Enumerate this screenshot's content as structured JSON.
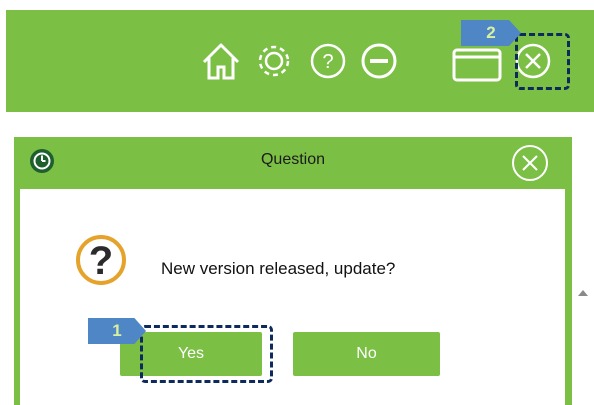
{
  "window": {
    "icons": [
      "home-icon",
      "gear-icon",
      "help-icon",
      "minimize-icon",
      "maximize-icon",
      "close-icon"
    ],
    "accent_color": "#7cbf45"
  },
  "annotations": {
    "step1": "1",
    "step2": "2",
    "badge_color": "#4f86c6",
    "highlight_color": "#0d2a5c"
  },
  "dialog": {
    "title": "Question",
    "message": "New version released, update?",
    "yes_label": "Yes",
    "no_label": "No",
    "icon": "question-icon"
  }
}
